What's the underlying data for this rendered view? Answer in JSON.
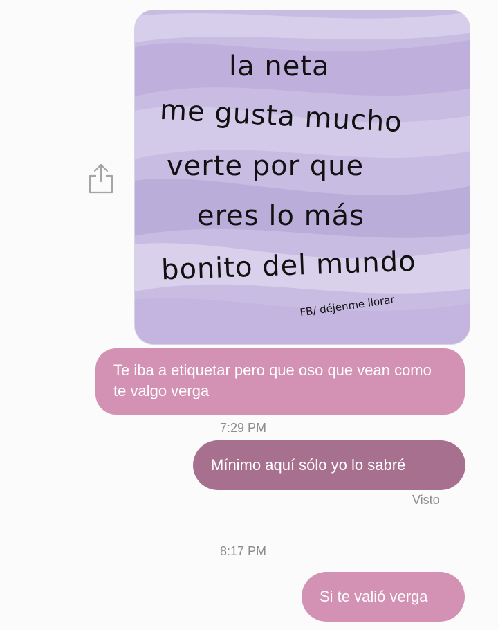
{
  "share": {
    "icon": "share-icon"
  },
  "image_message": {
    "lines": [
      "la neta",
      "me gusta mucho",
      "verte por que",
      "eres lo más",
      "bonito del mundo"
    ],
    "credit": "FB/ déjenme llorar"
  },
  "messages": [
    {
      "text": "Te iba a etiquetar pero que oso que vean como te valgo verga"
    },
    {
      "text": "Mínimo aquí sólo yo lo sabré"
    },
    {
      "text": "Si te valió verga"
    }
  ],
  "timestamps": [
    "7:29 PM",
    "8:17 PM"
  ],
  "status": {
    "seen": "Visto"
  },
  "colors": {
    "incoming_bubble": "#d391b4",
    "outgoing_bubble": "#a8708f",
    "image_background": "#c9bde3"
  }
}
